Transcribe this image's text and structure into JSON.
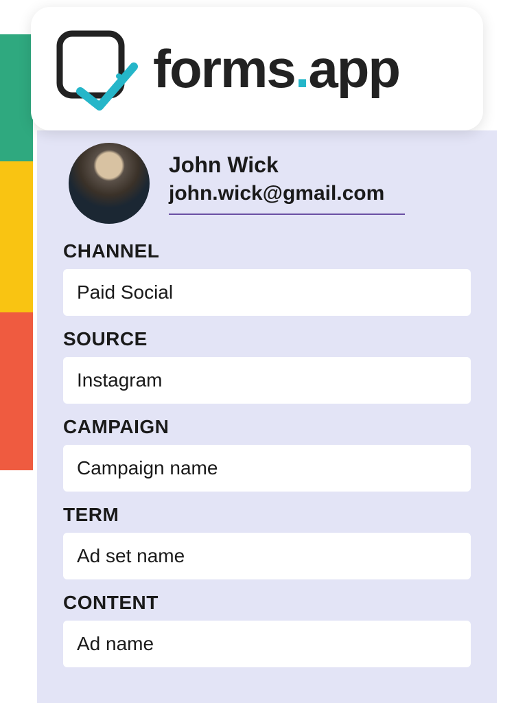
{
  "brand": {
    "name_part1": "forms",
    "name_dot": ".",
    "name_part2": "app"
  },
  "user": {
    "name": "John Wick",
    "email": "john.wick@gmail.com"
  },
  "fields": {
    "channel": {
      "label": "CHANNEL",
      "value": "Paid Social"
    },
    "source": {
      "label": "SOURCE",
      "value": "Instagram"
    },
    "campaign": {
      "label": "CAMPAIGN",
      "value": "Campaign name"
    },
    "term": {
      "label": "TERM",
      "value": "Ad set name"
    },
    "content": {
      "label": "CONTENT",
      "value": "Ad name"
    }
  },
  "colors": {
    "green": "#2fa97f",
    "yellow": "#f9c412",
    "red": "#ef5b40",
    "panel": "#e3e4f6",
    "accent": "#25b6c9"
  }
}
